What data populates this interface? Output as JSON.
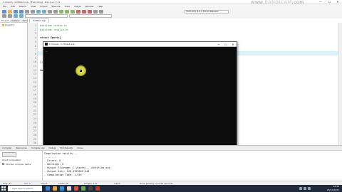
{
  "window": {
    "title": "C:\\Users\\...\\Untitled.cpp - [Executing] - Dev-C++ 5.11",
    "minimize": "—",
    "maximize": "☐",
    "close": "✕"
  },
  "watermark": {
    "prefix": "www.",
    "brand": "BANDICAM",
    "suffix": ".com"
  },
  "menu": [
    "File",
    "Edit",
    "Search",
    "View",
    "Project",
    "Execute",
    "Tools",
    "AStyle",
    "Window",
    "Help"
  ],
  "toolbar": {
    "compiler_combo": "TDM-GCC 4.9.2 64-bit Release"
  },
  "project_panel": {
    "tabs": [
      "Project",
      "Classes",
      "Debug"
    ],
    "tree_item": "Project1"
  },
  "editor": {
    "tab_label": "Untitled.cpp",
    "lines": [
      {
        "n": "1",
        "text": "#include <stdio.h>",
        "style": "green"
      },
      {
        "n": "2",
        "text": "#include <stdlib.h>",
        "style": "green"
      },
      {
        "n": "3",
        "text": "",
        "style": ""
      },
      {
        "n": "4",
        "text": "struct Sports{",
        "style": "bold"
      },
      {
        "n": "5",
        "text": "",
        "style": ""
      },
      {
        "n": "6",
        "text": "",
        "style": ""
      },
      {
        "n": "7",
        "text": "",
        "style": ""
      },
      {
        "n": "8",
        "text": "",
        "style": ""
      },
      {
        "n": "9",
        "text": "",
        "style": ""
      },
      {
        "n": "10",
        "text": "};",
        "style": ""
      },
      {
        "n": "11",
        "text": "",
        "style": ""
      },
      {
        "n": "12",
        "text": "int",
        "style": "bold"
      }
    ],
    "more_line_numbers": [
      "13",
      "14",
      "15",
      "16",
      "17",
      "18",
      "19",
      "20",
      "21",
      "22",
      "23",
      "24",
      "25",
      "26",
      "27",
      "28",
      "29",
      "30",
      "31",
      "32"
    ],
    "closing_brace": "}"
  },
  "console": {
    "title": "C:\\Users\\...\\Untitled.exe",
    "output": "_",
    "close": "✕",
    "minimize": "—",
    "maximize": "☐"
  },
  "bottom_panel": {
    "tabs": [
      "Compiler",
      "Resources",
      "Compile Log",
      "Debug",
      "Find Results",
      "Close"
    ],
    "abort_label": "Abort Compilation",
    "shorten_label": "Shorten compiler paths",
    "log": [
      "Compilation results...",
      "--------",
      "- Errors: 0",
      "- Warnings: 0",
      "- Output Filename: C:\\Users\\...\\Untitled.exe",
      "- Output Size: 128.4765625 KiB",
      "- Compilation Time: 1.91s"
    ]
  },
  "statusbar": {
    "line": "Line: 31",
    "col": "Col: 3",
    "sel": "Sel: 0",
    "lines": "Lines: 32",
    "length": "Length: 311",
    "insert": "Insert",
    "done": "Done parsing in 0.016 seconds"
  },
  "taskbar": {
    "search_placeholder": "Type here to search",
    "time": "18:46",
    "date": "20/11/2021"
  },
  "colors": {
    "console_bg": "#0c0c0c",
    "taskbar_bg": "#1f2a3a",
    "highlight_line": "#d8f2fb",
    "include_green": "#2e8b2e"
  }
}
